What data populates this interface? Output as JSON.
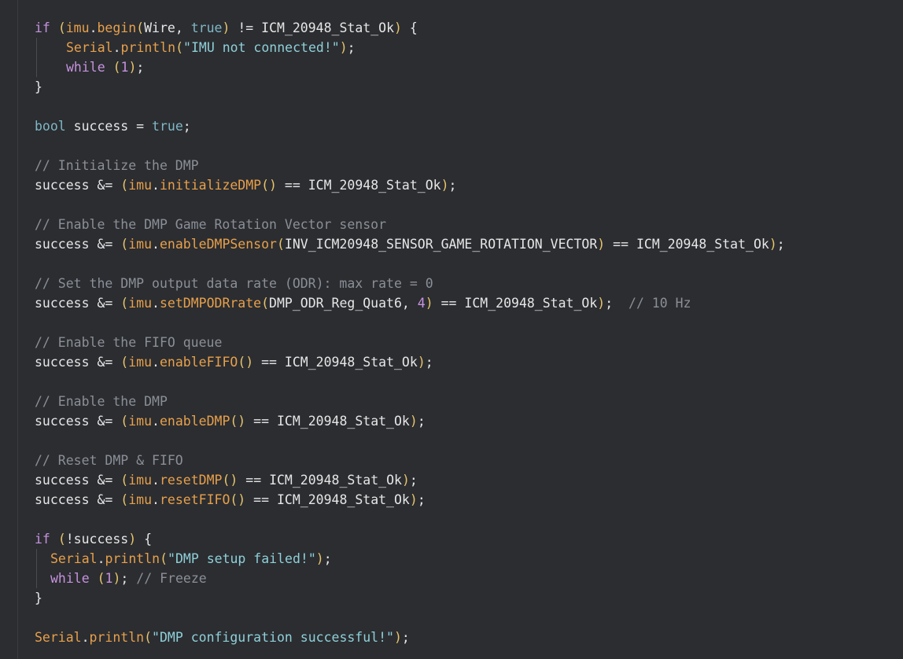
{
  "lines": [
    {
      "indent": 0,
      "tokens": [
        [
          "kw",
          "if"
        ],
        [
          "punc",
          " "
        ],
        [
          "paren",
          "("
        ],
        [
          "obj",
          "imu"
        ],
        [
          "punc",
          "."
        ],
        [
          "fn",
          "begin"
        ],
        [
          "paren",
          "("
        ],
        [
          "ident",
          "Wire, "
        ],
        [
          "lit",
          "true"
        ],
        [
          "paren",
          ")"
        ],
        [
          "punc",
          " != ICM_20948_Stat_Ok"
        ],
        [
          "paren",
          ")"
        ],
        [
          "punc",
          " {"
        ]
      ]
    },
    {
      "indent": 1,
      "guide": true,
      "tokens": [
        [
          "obj",
          "Serial"
        ],
        [
          "punc",
          "."
        ],
        [
          "fn",
          "println"
        ],
        [
          "paren",
          "("
        ],
        [
          "str",
          "\"IMU not connected!\""
        ],
        [
          "paren",
          ")"
        ],
        [
          "punc",
          ";"
        ]
      ]
    },
    {
      "indent": 1,
      "guide": true,
      "tokens": [
        [
          "kw",
          "while"
        ],
        [
          "punc",
          " "
        ],
        [
          "paren",
          "("
        ],
        [
          "num",
          "1"
        ],
        [
          "paren",
          ")"
        ],
        [
          "punc",
          ";"
        ]
      ]
    },
    {
      "indent": 0,
      "tokens": [
        [
          "punc",
          "}"
        ]
      ]
    },
    {
      "indent": 0,
      "tokens": []
    },
    {
      "indent": 0,
      "tokens": [
        [
          "type",
          "bool"
        ],
        [
          "ident",
          " success = "
        ],
        [
          "lit",
          "true"
        ],
        [
          "punc",
          ";"
        ]
      ]
    },
    {
      "indent": 0,
      "tokens": []
    },
    {
      "indent": 0,
      "tokens": [
        [
          "cmt",
          "// Initialize the DMP"
        ]
      ]
    },
    {
      "indent": 0,
      "tokens": [
        [
          "ident",
          "success &= "
        ],
        [
          "paren",
          "("
        ],
        [
          "obj",
          "imu"
        ],
        [
          "punc",
          "."
        ],
        [
          "fn",
          "initializeDMP"
        ],
        [
          "paren",
          "()"
        ],
        [
          "punc",
          " == ICM_20948_Stat_Ok"
        ],
        [
          "paren",
          ")"
        ],
        [
          "punc",
          ";"
        ]
      ]
    },
    {
      "indent": 0,
      "tokens": []
    },
    {
      "indent": 0,
      "tokens": [
        [
          "cmt",
          "// Enable the DMP Game Rotation Vector sensor"
        ]
      ]
    },
    {
      "indent": 0,
      "tokens": [
        [
          "ident",
          "success &= "
        ],
        [
          "paren",
          "("
        ],
        [
          "obj",
          "imu"
        ],
        [
          "punc",
          "."
        ],
        [
          "fn",
          "enableDMPSensor"
        ],
        [
          "paren",
          "("
        ],
        [
          "ident",
          "INV_ICM20948_SENSOR_GAME_ROTATION_VECTOR"
        ],
        [
          "paren",
          ")"
        ],
        [
          "punc",
          " == ICM_20948_Stat_Ok"
        ],
        [
          "paren",
          ")"
        ],
        [
          "punc",
          ";"
        ]
      ]
    },
    {
      "indent": 0,
      "tokens": []
    },
    {
      "indent": 0,
      "tokens": [
        [
          "cmt",
          "// Set the DMP output data rate (ODR): max rate = 0"
        ]
      ]
    },
    {
      "indent": 0,
      "tokens": [
        [
          "ident",
          "success &= "
        ],
        [
          "paren",
          "("
        ],
        [
          "obj",
          "imu"
        ],
        [
          "punc",
          "."
        ],
        [
          "fn",
          "setDMPODRrate"
        ],
        [
          "paren",
          "("
        ],
        [
          "ident",
          "DMP_ODR_Reg_Quat6, "
        ],
        [
          "num",
          "4"
        ],
        [
          "paren",
          ")"
        ],
        [
          "punc",
          " == ICM_20948_Stat_Ok"
        ],
        [
          "paren",
          ")"
        ],
        [
          "punc",
          ";  "
        ],
        [
          "cmt",
          "// 10 Hz"
        ]
      ]
    },
    {
      "indent": 0,
      "tokens": []
    },
    {
      "indent": 0,
      "tokens": [
        [
          "cmt",
          "// Enable the FIFO queue"
        ]
      ]
    },
    {
      "indent": 0,
      "tokens": [
        [
          "ident",
          "success &= "
        ],
        [
          "paren",
          "("
        ],
        [
          "obj",
          "imu"
        ],
        [
          "punc",
          "."
        ],
        [
          "fn",
          "enableFIFO"
        ],
        [
          "paren",
          "()"
        ],
        [
          "punc",
          " == ICM_20948_Stat_Ok"
        ],
        [
          "paren",
          ")"
        ],
        [
          "punc",
          ";"
        ]
      ]
    },
    {
      "indent": 0,
      "tokens": []
    },
    {
      "indent": 0,
      "tokens": [
        [
          "cmt",
          "// Enable the DMP"
        ]
      ]
    },
    {
      "indent": 0,
      "tokens": [
        [
          "ident",
          "success &= "
        ],
        [
          "paren",
          "("
        ],
        [
          "obj",
          "imu"
        ],
        [
          "punc",
          "."
        ],
        [
          "fn",
          "enableDMP"
        ],
        [
          "paren",
          "()"
        ],
        [
          "punc",
          " == ICM_20948_Stat_Ok"
        ],
        [
          "paren",
          ")"
        ],
        [
          "punc",
          ";"
        ]
      ]
    },
    {
      "indent": 0,
      "tokens": []
    },
    {
      "indent": 0,
      "tokens": [
        [
          "cmt",
          "// Reset DMP & FIFO"
        ]
      ]
    },
    {
      "indent": 0,
      "tokens": [
        [
          "ident",
          "success &= "
        ],
        [
          "paren",
          "("
        ],
        [
          "obj",
          "imu"
        ],
        [
          "punc",
          "."
        ],
        [
          "fn",
          "resetDMP"
        ],
        [
          "paren",
          "()"
        ],
        [
          "punc",
          " == ICM_20948_Stat_Ok"
        ],
        [
          "paren",
          ")"
        ],
        [
          "punc",
          ";"
        ]
      ]
    },
    {
      "indent": 0,
      "tokens": [
        [
          "ident",
          "success &= "
        ],
        [
          "paren",
          "("
        ],
        [
          "obj",
          "imu"
        ],
        [
          "punc",
          "."
        ],
        [
          "fn",
          "resetFIFO"
        ],
        [
          "paren",
          "()"
        ],
        [
          "punc",
          " == ICM_20948_Stat_Ok"
        ],
        [
          "paren",
          ")"
        ],
        [
          "punc",
          ";"
        ]
      ]
    },
    {
      "indent": 0,
      "tokens": []
    },
    {
      "indent": 0,
      "tokens": [
        [
          "kw",
          "if"
        ],
        [
          "punc",
          " "
        ],
        [
          "paren",
          "("
        ],
        [
          "ident",
          "!success"
        ],
        [
          "paren",
          ")"
        ],
        [
          "punc",
          " {"
        ]
      ]
    },
    {
      "indent": 2,
      "guide": true,
      "tokens": [
        [
          "obj",
          "Serial"
        ],
        [
          "punc",
          "."
        ],
        [
          "fn",
          "println"
        ],
        [
          "paren",
          "("
        ],
        [
          "str",
          "\"DMP setup failed!\""
        ],
        [
          "paren",
          ")"
        ],
        [
          "punc",
          ";"
        ]
      ]
    },
    {
      "indent": 2,
      "guide": true,
      "tokens": [
        [
          "kw",
          "while"
        ],
        [
          "punc",
          " "
        ],
        [
          "paren",
          "("
        ],
        [
          "num",
          "1"
        ],
        [
          "paren",
          ")"
        ],
        [
          "punc",
          "; "
        ],
        [
          "cmt",
          "// Freeze"
        ]
      ]
    },
    {
      "indent": 0,
      "tokens": [
        [
          "punc",
          "}"
        ]
      ]
    },
    {
      "indent": 0,
      "tokens": []
    },
    {
      "indent": 0,
      "tokens": [
        [
          "obj",
          "Serial"
        ],
        [
          "punc",
          "."
        ],
        [
          "fn",
          "println"
        ],
        [
          "paren",
          "("
        ],
        [
          "str",
          "\"DMP configuration successful!\""
        ],
        [
          "paren",
          ")"
        ],
        [
          "punc",
          ";"
        ]
      ]
    }
  ]
}
